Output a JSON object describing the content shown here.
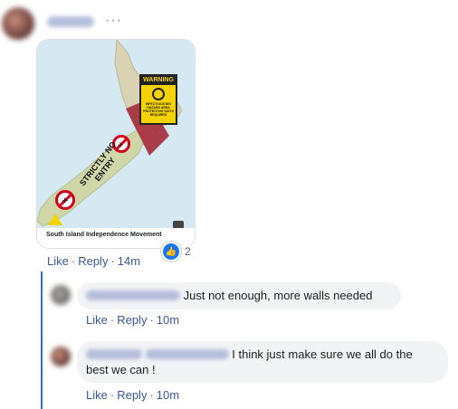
{
  "post": {
    "image": {
      "warning_label": "WARNING",
      "warning_subtext": "INFECTIOUS BIO HAZARD AREA PROTECTIVE SUITS REQUIRED",
      "stamp_text": "STRICTLY NO ENTRY",
      "caption": "South Island Independence Movement"
    },
    "actions": {
      "like": "Like",
      "reply": "Reply",
      "time": "14m"
    },
    "reactions": {
      "count": "2"
    }
  },
  "comments": [
    {
      "text": "Just not enough, more walls needed",
      "actions": {
        "like": "Like",
        "reply": "Reply",
        "time": "10m"
      }
    },
    {
      "text_line1": "I think just make sure we all do the",
      "text_line2": "best we can !",
      "actions": {
        "like": "Like",
        "reply": "Reply",
        "time": "10m"
      }
    }
  ],
  "colors": {
    "link": "#385898",
    "thread": "#2f6fe0",
    "like_blue": "#1877f2",
    "bubble": "#f2f3f5"
  }
}
